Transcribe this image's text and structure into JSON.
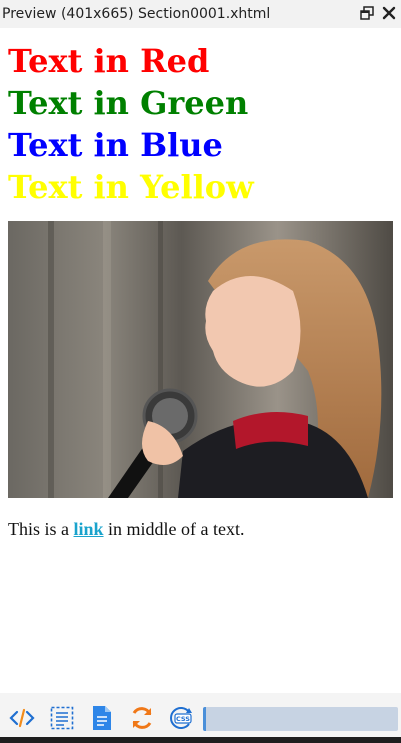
{
  "window": {
    "title": "Preview (401x665) Section0001.xhtml",
    "restore_icon": "restore-window-icon",
    "close_icon": "close-icon"
  },
  "headings": [
    {
      "text": "Text in Red",
      "color": "#ff0000"
    },
    {
      "text": "Text in Green",
      "color": "#008000"
    },
    {
      "text": "Text in Blue",
      "color": "#0000ff"
    },
    {
      "text": "Text in Yellow",
      "color": "#ffff00"
    }
  ],
  "paragraph": {
    "before": "This is a ",
    "link": "link",
    "after": " in middle of a text."
  },
  "toolbar": {
    "items": [
      "code-view-icon",
      "select-text-icon",
      "document-icon",
      "refresh-icon",
      "css-icon"
    ],
    "progress_color": "#c7d3e3"
  }
}
